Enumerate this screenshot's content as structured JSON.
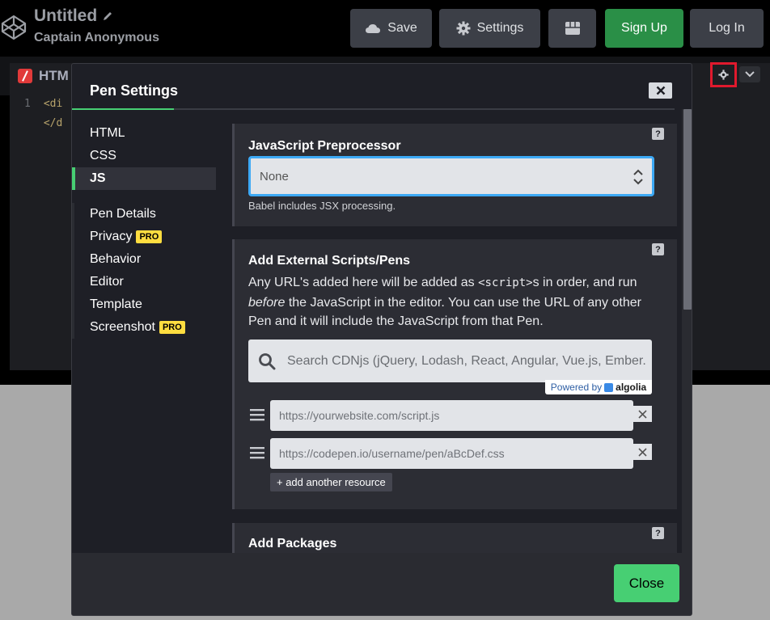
{
  "header": {
    "title": "Untitled",
    "author": "Captain Anonymous",
    "save_label": "Save",
    "settings_label": "Settings",
    "signup_label": "Sign Up",
    "login_label": "Log In"
  },
  "editor": {
    "tab_label": "HTM",
    "line_number": "1",
    "line1": "<di",
    "line2": "</d"
  },
  "modal": {
    "title": "Pen Settings",
    "sidebar_primary": [
      {
        "label": "HTML"
      },
      {
        "label": "CSS"
      },
      {
        "label": "JS"
      }
    ],
    "sidebar_secondary": [
      {
        "label": "Pen Details"
      },
      {
        "label": "Privacy",
        "badge": "PRO"
      },
      {
        "label": "Behavior"
      },
      {
        "label": "Editor"
      },
      {
        "label": "Template"
      },
      {
        "label": "Screenshot",
        "badge": "PRO"
      }
    ],
    "preprocessor": {
      "heading": "JavaScript Preprocessor",
      "selected": "None",
      "hint": "Babel includes JSX processing."
    },
    "external": {
      "heading": "Add External Scripts/Pens",
      "desc_part1": "Any URL's added here will be added as ",
      "desc_code": "<script>",
      "desc_part2": "s in order, and run ",
      "desc_em": "before",
      "desc_part3": " the JavaScript in the editor. You can use the URL of any other Pen and it will include the JavaScript from that Pen.",
      "search_placeholder": "Search CDNjs (jQuery, Lodash, React, Angular, Vue.js, Ember.",
      "powered_by": "Powered by",
      "algolia": "algolia",
      "resources": [
        {
          "placeholder": "https://yourwebsite.com/script.js"
        },
        {
          "placeholder": "https://codepen.io/username/pen/aBcDef.css"
        }
      ],
      "add_label": "+ add another resource"
    },
    "packages": {
      "heading": "Add Packages"
    },
    "help_label": "?",
    "close_label": "Close"
  },
  "colors": {
    "accent": "#47cf73",
    "focus": "#3da9f5",
    "pro_badge": "#ffdd40",
    "highlight_box": "#e0192d"
  }
}
